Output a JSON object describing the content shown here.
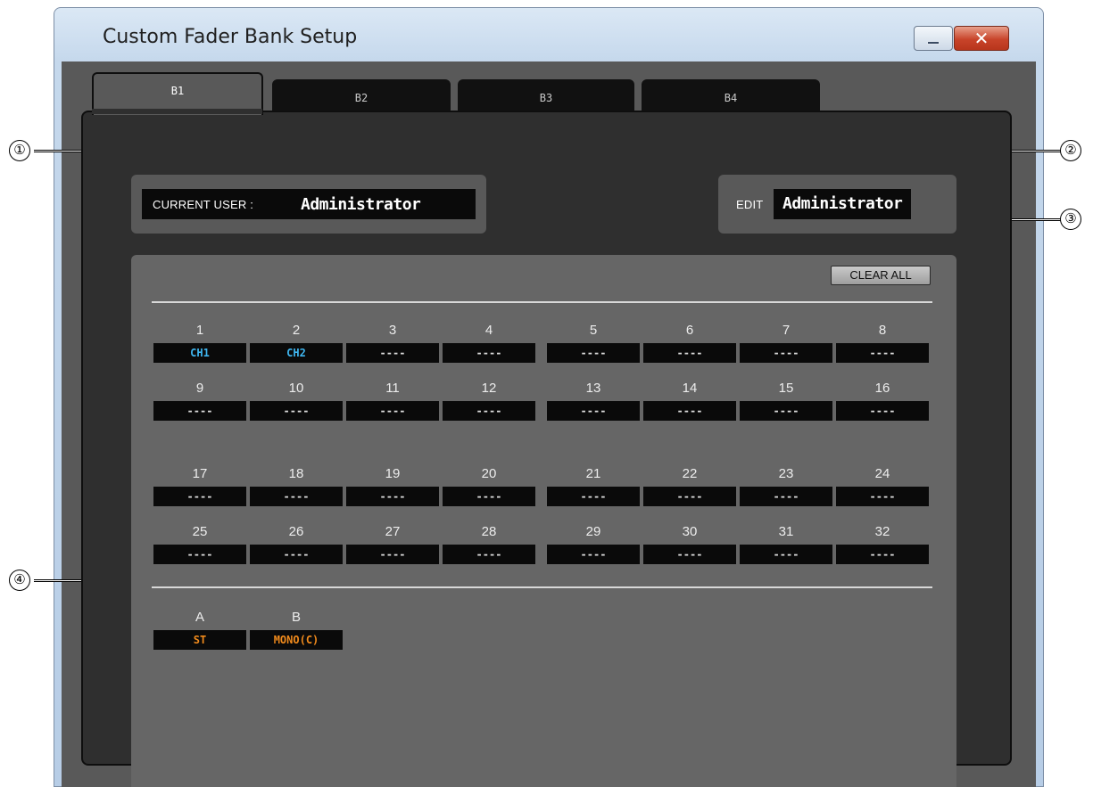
{
  "window": {
    "title": "Custom Fader Bank Setup",
    "minimize_label": "",
    "close_label": "✕"
  },
  "tabs": [
    {
      "label": "B1",
      "active": true
    },
    {
      "label": "B2",
      "active": false
    },
    {
      "label": "B3",
      "active": false
    },
    {
      "label": "B4",
      "active": false
    }
  ],
  "current_user": {
    "label": "CURRENT USER :",
    "value": "Administrator"
  },
  "edit_user": {
    "label": "EDIT",
    "value": "Administrator"
  },
  "clear_all_label": "CLEAR ALL",
  "fader_rows": [
    [
      {
        "num": "1",
        "value": "CH1"
      },
      {
        "num": "2",
        "value": "CH2"
      },
      {
        "num": "3",
        "value": "----"
      },
      {
        "num": "4",
        "value": "----"
      },
      {
        "num": "5",
        "value": "----"
      },
      {
        "num": "6",
        "value": "----"
      },
      {
        "num": "7",
        "value": "----"
      },
      {
        "num": "8",
        "value": "----"
      }
    ],
    [
      {
        "num": "9",
        "value": "----"
      },
      {
        "num": "10",
        "value": "----"
      },
      {
        "num": "11",
        "value": "----"
      },
      {
        "num": "12",
        "value": "----"
      },
      {
        "num": "13",
        "value": "----"
      },
      {
        "num": "14",
        "value": "----"
      },
      {
        "num": "15",
        "value": "----"
      },
      {
        "num": "16",
        "value": "----"
      }
    ],
    [
      {
        "num": "17",
        "value": "----"
      },
      {
        "num": "18",
        "value": "----"
      },
      {
        "num": "19",
        "value": "----"
      },
      {
        "num": "20",
        "value": "----"
      },
      {
        "num": "21",
        "value": "----"
      },
      {
        "num": "22",
        "value": "----"
      },
      {
        "num": "23",
        "value": "----"
      },
      {
        "num": "24",
        "value": "----"
      }
    ],
    [
      {
        "num": "25",
        "value": "----"
      },
      {
        "num": "26",
        "value": "----"
      },
      {
        "num": "27",
        "value": "----"
      },
      {
        "num": "28",
        "value": "----"
      },
      {
        "num": "29",
        "value": "----"
      },
      {
        "num": "30",
        "value": "----"
      },
      {
        "num": "31",
        "value": "----"
      },
      {
        "num": "32",
        "value": "----"
      }
    ]
  ],
  "master_slots": [
    {
      "num": "A",
      "value": "ST"
    },
    {
      "num": "B",
      "value": "MONO(C)"
    }
  ],
  "colors": {
    "channel_text": "#3fb6f0",
    "master_text": "#f08a1c",
    "empty_text": "#dcdcdc"
  },
  "callouts": [
    "①",
    "②",
    "③",
    "④"
  ]
}
